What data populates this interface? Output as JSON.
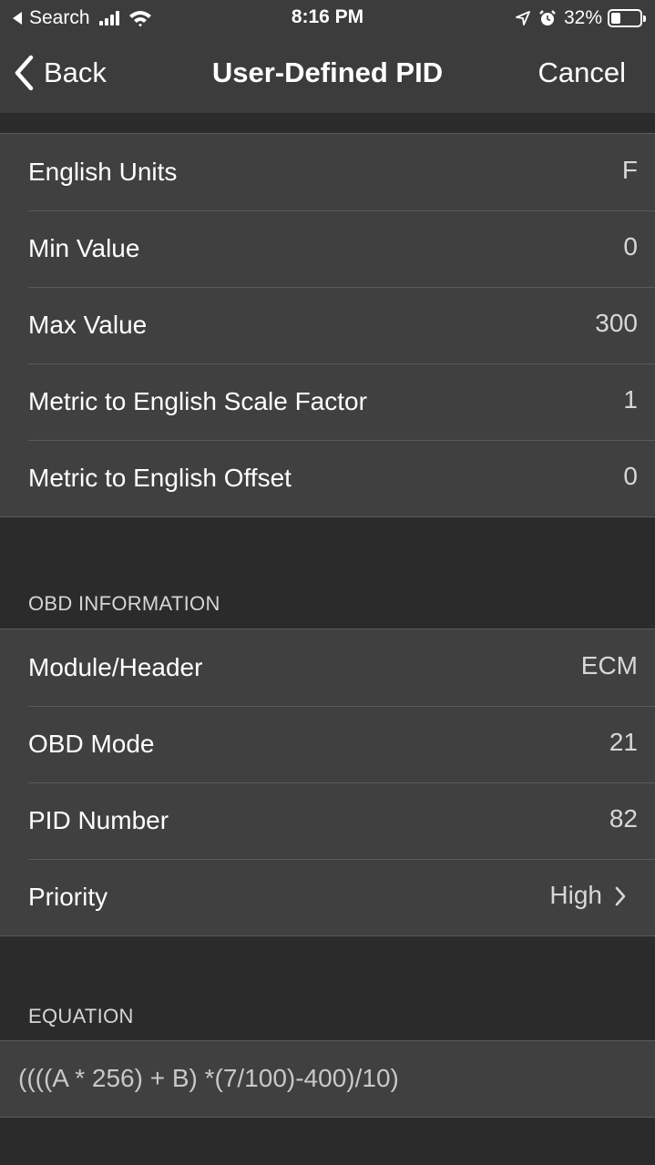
{
  "status_bar": {
    "carrier": "Search",
    "time": "8:16 PM",
    "battery_percent": "32%",
    "battery_level": 0.32
  },
  "nav": {
    "back_label": "Back",
    "title": "User-Defined PID",
    "cancel_label": "Cancel"
  },
  "units_group": {
    "rows": [
      {
        "label": "English Units",
        "value": "F"
      },
      {
        "label": "Min Value",
        "value": "0"
      },
      {
        "label": "Max Value",
        "value": "300"
      },
      {
        "label": "Metric to English Scale Factor",
        "value": "1"
      },
      {
        "label": "Metric to English Offset",
        "value": "0"
      }
    ]
  },
  "obd_section": {
    "header": "OBD INFORMATION",
    "rows": [
      {
        "label": "Module/Header",
        "value": "ECM"
      },
      {
        "label": "OBD Mode",
        "value": "21"
      },
      {
        "label": "PID Number",
        "value": "82"
      },
      {
        "label": "Priority",
        "value": "High"
      }
    ]
  },
  "equation_section": {
    "header": "EQUATION",
    "value": "((((A * 256) + B) *(7/100)-400)/10)"
  }
}
